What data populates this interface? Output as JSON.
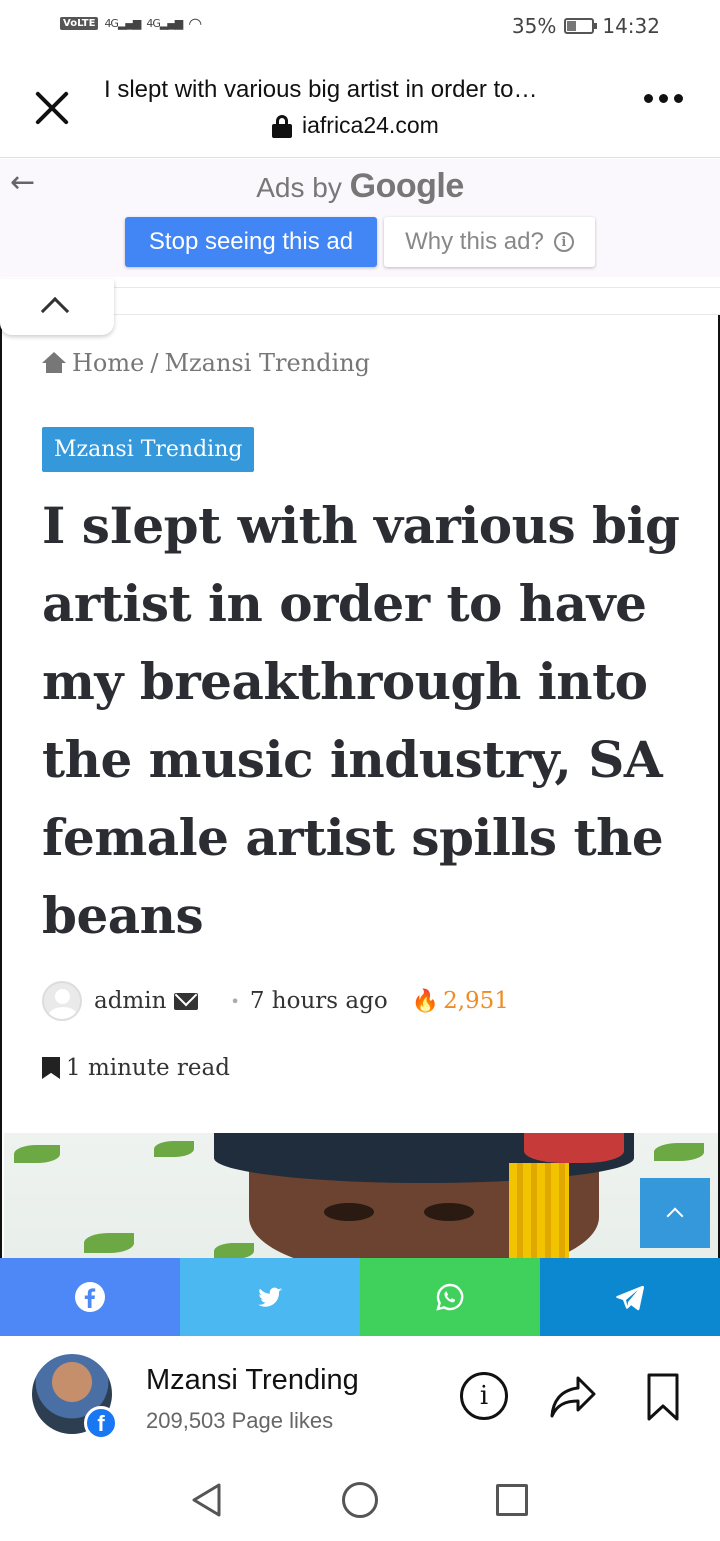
{
  "status_bar": {
    "volte": "VoLTE",
    "network_1": "4G",
    "network_2": "4G",
    "battery_percent": "35%",
    "battery_level": 0.35,
    "time": "14:32"
  },
  "browser": {
    "page_title": "I slept with various big artist in order to…",
    "url": "iafrica24.com"
  },
  "ad": {
    "ads_by": "Ads by",
    "google": "Google",
    "stop_label": "Stop seeing this ad",
    "why_label": "Why this ad?"
  },
  "breadcrumb": {
    "home": "Home",
    "separator": "/",
    "current": "Mzansi Trending"
  },
  "article": {
    "category": "Mzansi Trending",
    "headline": "I sIept with various big artist in order to have my breakthrough into the music industry, SA female artist spills the beans",
    "author": "admin",
    "time_ago": "7 hours ago",
    "views": "2,951",
    "read_time": "1 minute read"
  },
  "share_colors": {
    "facebook": "#4e88f6",
    "twitter": "#4bb8f2",
    "whatsapp": "#3fd15b",
    "telegram": "#0b88cf"
  },
  "footer": {
    "page_name": "Mzansi Trending",
    "page_likes": "209,503 Page likes"
  },
  "accent_color": "#3498db"
}
